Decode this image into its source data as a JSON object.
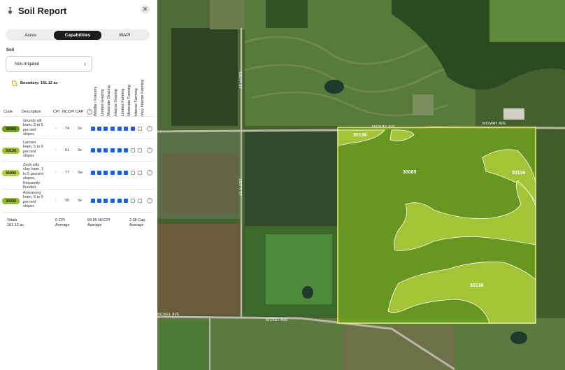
{
  "panel": {
    "title": "Soil Report",
    "logo_icon": "shovel-icon",
    "close_icon": "close-icon",
    "close_label": "✕",
    "tabs": [
      {
        "label": "Acres",
        "active": false
      },
      {
        "label": "Capabilities",
        "active": true
      },
      {
        "label": "WAPI",
        "active": false
      }
    ],
    "soil_label": "Soil",
    "soil_select_value": "Non-Irrigated",
    "soil_select_chevron": "›",
    "boundary_label": "Boundary: 161.12 ac",
    "headers": {
      "code": "Code",
      "description": "Description",
      "cpi": "CPI",
      "nccpi": "NCCPI",
      "cap": "CAP",
      "help": "?",
      "capabilities": [
        "Wildlife / Forestry",
        "Limited Grazing",
        "Moderate Grazing",
        "Intense Grazing",
        "Limited Farming",
        "Moderate Farming",
        "Intense Farming",
        "Very Intense Farming"
      ]
    },
    "rows": [
      {
        "code": "30085",
        "color": "#6fa31f",
        "description": [
          "Grundy silt",
          "loam, 2 to 5",
          "percent",
          "slopes"
        ],
        "cpi": "-",
        "nccpi": "74",
        "cap": "2e",
        "filled": 7
      },
      {
        "code": "30136",
        "color": "#a3c235",
        "description": [
          "Lamoni",
          "loam, 5 to 9",
          "percent",
          "slopes"
        ],
        "cpi": "-",
        "nccpi": "61",
        "cap": "3e",
        "filled": 6
      },
      {
        "code": "36096",
        "color": "#b4cf44",
        "description": [
          "Zook silty",
          "clay loam, 1",
          "to 5 percent",
          "slopes,",
          "frequently",
          "flooded"
        ],
        "cpi": "-",
        "nccpi": "77",
        "cap": "3w",
        "filled": 6
      },
      {
        "code": "30036",
        "color": "#94b92f",
        "description": [
          "Armstrong",
          "loam, 5 to 9",
          "percent",
          "slopes"
        ],
        "cpi": "-",
        "nccpi": "56",
        "cap": "3e",
        "filled": 6
      }
    ],
    "totals": {
      "label": "Totals",
      "acres": "161.12 ac",
      "cpi_value": "0 CPI",
      "cpi_caption": "Average",
      "nccpi_value": "69.95 NCCPI",
      "nccpi_caption": "Average",
      "cap_value": "2.38 Cap.",
      "cap_caption": "Average"
    }
  },
  "map": {
    "roads": {
      "midway_top": "MIDWAY AVE",
      "midway_left": "MIDWAY AVE",
      "nickel_left": "NICKEL AVE",
      "nickel_right": "NICKEL AVE",
      "north_upper": "190TH ST",
      "north_lower": "190TH ST"
    },
    "soil_labels": [
      "30136",
      "30085",
      "30136",
      "30136"
    ],
    "colors": {
      "main_soil": "#6fa31f",
      "light_soil": "#b5d13e",
      "boundary": "#f2f06a",
      "panel_accent": "#1a5ee8"
    }
  }
}
